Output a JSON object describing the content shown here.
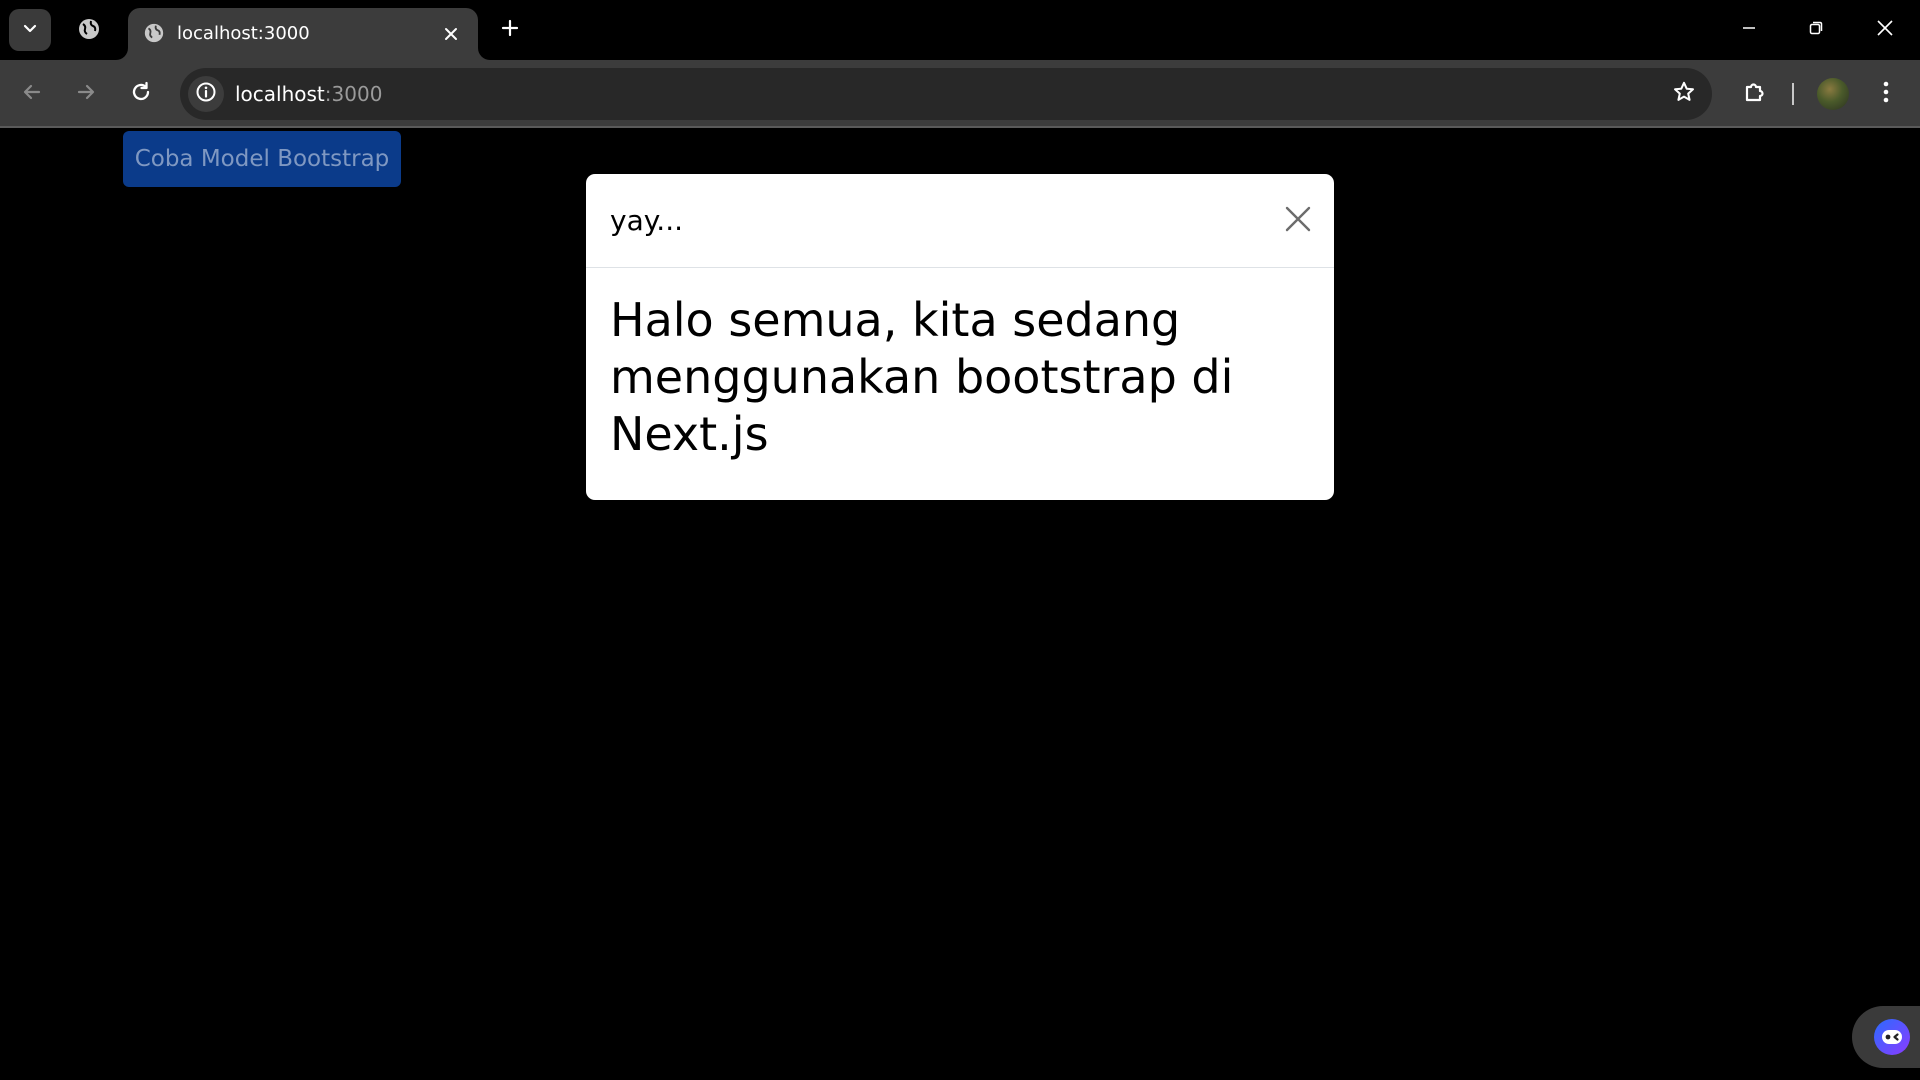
{
  "browser": {
    "tab": {
      "title": "localhost:3000"
    },
    "address": {
      "host": "localhost",
      "port": ":3000"
    }
  },
  "page": {
    "launch_button_label": "Coba Model Bootstrap",
    "modal": {
      "title": "yay...",
      "body": "Halo semua, kita sedang menggunakan bootstrap di Next.js"
    }
  },
  "colors": {
    "launch_button_bg": "#0b3b8a",
    "modal_bg": "#ffffff",
    "page_bg": "#000000"
  }
}
